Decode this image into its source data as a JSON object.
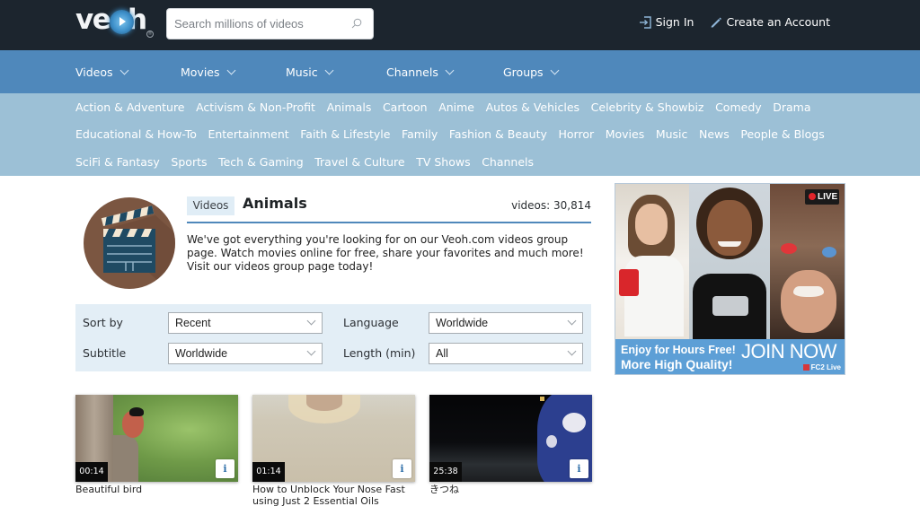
{
  "header": {
    "logo_text": "veoh",
    "search_placeholder": "Search millions of videos",
    "sign_in_label": "Sign In",
    "create_account_label": "Create an Account"
  },
  "main_nav": [
    {
      "label": "Videos"
    },
    {
      "label": "Movies"
    },
    {
      "label": "Music"
    },
    {
      "label": "Channels"
    },
    {
      "label": "Groups"
    }
  ],
  "categories": {
    "row1": [
      "Action & Adventure",
      "Activism & Non-Profit",
      "Animals",
      "Cartoon",
      "Anime",
      "Autos & Vehicles",
      "Celebrity & Showbiz",
      "Comedy",
      "Drama"
    ],
    "row2": [
      "Educational & How-To",
      "Entertainment",
      "Faith & Lifestyle",
      "Family",
      "Fashion & Beauty",
      "Horror",
      "Movies",
      "Music",
      "News",
      "People & Blogs"
    ],
    "row3": [
      "SciFi & Fantasy",
      "Sports",
      "Tech & Gaming",
      "Travel & Culture",
      "TV Shows",
      "Channels"
    ]
  },
  "group": {
    "tag": "Videos",
    "title": "Animals",
    "count_text": "videos: 30,814",
    "description": "We've got everything you're looking for on our Veoh.com videos group page. Watch movies online for free, share your favorites and much more! Visit our videos group page today!"
  },
  "filters": {
    "sort_by": {
      "label": "Sort by",
      "value": "Recent"
    },
    "language": {
      "label": "Language",
      "value": "Worldwide"
    },
    "subtitle": {
      "label": "Subtitle",
      "value": "Worldwide"
    },
    "length": {
      "label": "Length (min)",
      "value": "All"
    }
  },
  "videos": [
    {
      "title": "Beautiful bird",
      "duration": "00:14",
      "info_label": "i"
    },
    {
      "title": "How to Unblock Your Nose Fast using Just 2 Essential Oils",
      "duration": "01:14",
      "info_label": "i"
    },
    {
      "title": "きつね",
      "duration": "25:38",
      "info_label": "i"
    }
  ],
  "ad": {
    "live_badge": "LIVE",
    "line1": "Enjoy for Hours Free!",
    "line2": "More High Quality!",
    "cta": "JOIN NOW",
    "brand": "FC2 Live"
  },
  "colors": {
    "topbar": "#1c252e",
    "main_nav": "#4f88bb",
    "category_bar": "#9cc0d6",
    "filter_panel": "#e3eef6",
    "ad_banner": "#5d9fd6"
  }
}
